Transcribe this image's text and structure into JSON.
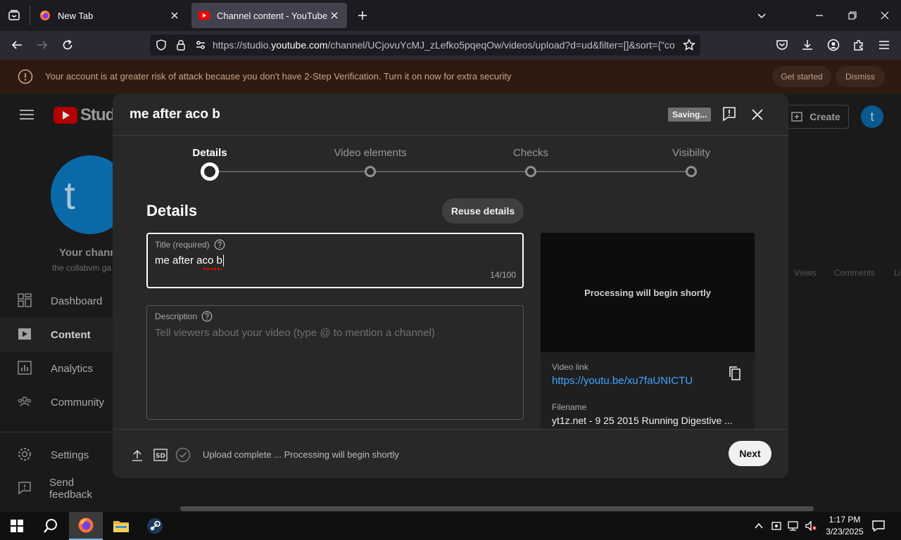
{
  "browser": {
    "tabs": [
      {
        "label": "New Tab",
        "active": false
      },
      {
        "label": "Channel content - YouTube Studio",
        "active": true
      }
    ],
    "url_prefix": "https://studio.",
    "url_domain": "youtube.com",
    "url_rest": "/channel/UCjovuYcMJ_zLefko5pqeqOw/videos/upload?d=ud&filter=[]&sort={\"co"
  },
  "banner": {
    "text": "Your account is at greater risk of attack because you don't have 2-Step Verification. Turn it on now for extra security",
    "get_started": "Get started",
    "dismiss": "Dismiss"
  },
  "studio": {
    "logo_text": "Studio",
    "avatar_letter": "t",
    "channel_label": "Your channel",
    "channel_name": "the collabvm ga",
    "create_label": "Create",
    "col_views": "Views",
    "col_comments": "Comments",
    "col_likes": "Li",
    "sidebar": [
      {
        "label": "Dashboard",
        "icon": "dashboard-icon"
      },
      {
        "label": "Content",
        "icon": "content-icon"
      },
      {
        "label": "Analytics",
        "icon": "analytics-icon"
      },
      {
        "label": "Community",
        "icon": "community-icon"
      },
      {
        "label": "Settings",
        "icon": "settings-icon"
      },
      {
        "label": "Send feedback",
        "icon": "feedback-icon"
      }
    ]
  },
  "dialog": {
    "title": "me after aco b",
    "saving": "Saving...",
    "steps": [
      "Details",
      "Video elements",
      "Checks",
      "Visibility"
    ],
    "details_heading": "Details",
    "reuse_details": "Reuse details",
    "title_field": {
      "label": "Title (required)",
      "value": "me after aco b",
      "counter": "14/100"
    },
    "description_field": {
      "label": "Description",
      "placeholder": "Tell viewers about your video (type @ to mention a channel)"
    },
    "preview": {
      "processing": "Processing will begin shortly",
      "video_link_label": "Video link",
      "video_link": "https://youtu.be/xu7faUNICTU",
      "filename_label": "Filename",
      "filename": "yt1z.net - 9 25 2015 Running Digestive ..."
    },
    "footer_status": "Upload complete ... Processing will begin shortly",
    "next": "Next"
  },
  "taskbar": {
    "time": "1:17 PM",
    "date": "3/23/2025"
  }
}
